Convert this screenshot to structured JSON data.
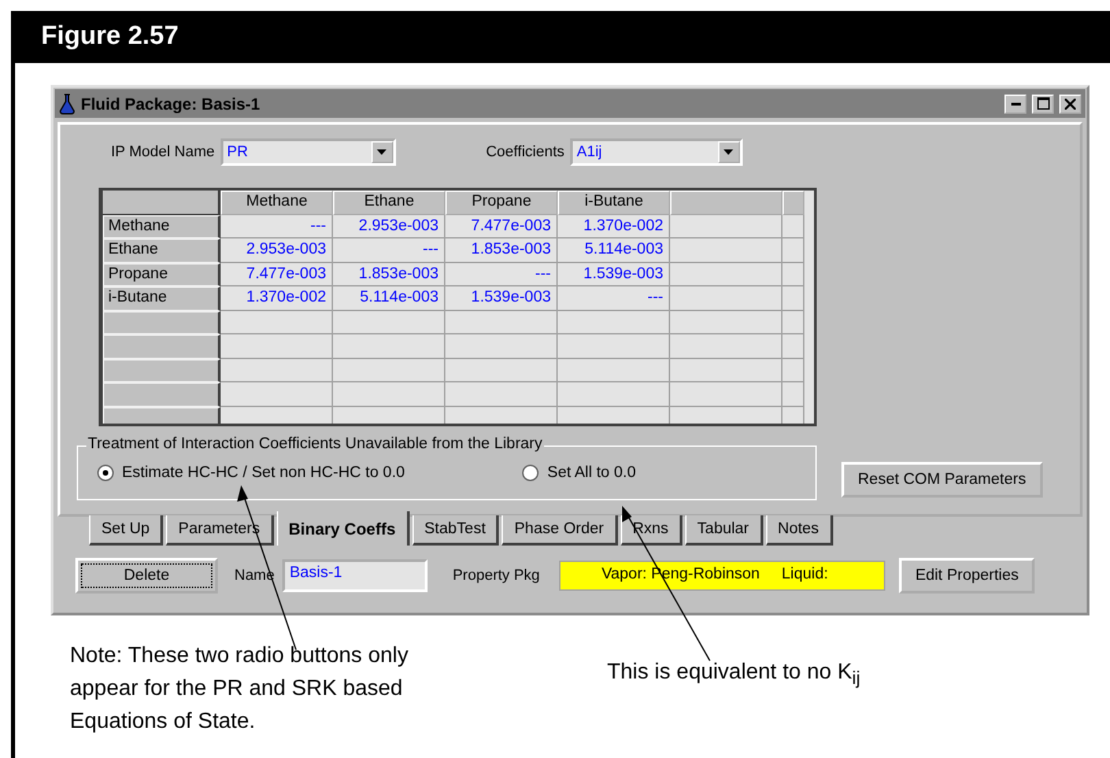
{
  "figure": {
    "title": "Figure 2.57"
  },
  "window": {
    "title": "Fluid Package: Basis-1"
  },
  "ip_model": {
    "label": "IP Model Name",
    "value": "PR"
  },
  "coefficients": {
    "label": "Coefficients",
    "value": "A1ij"
  },
  "table": {
    "columns": [
      "Methane",
      "Ethane",
      "Propane",
      "i-Butane"
    ],
    "rows": [
      {
        "name": "Methane",
        "cells": [
          "---",
          "2.953e-003",
          "7.477e-003",
          "1.370e-002"
        ]
      },
      {
        "name": "Ethane",
        "cells": [
          "2.953e-003",
          "---",
          "1.853e-003",
          "5.114e-003"
        ]
      },
      {
        "name": "Propane",
        "cells": [
          "7.477e-003",
          "1.853e-003",
          "---",
          "1.539e-003"
        ]
      },
      {
        "name": "i-Butane",
        "cells": [
          "1.370e-002",
          "5.114e-003",
          "1.539e-003",
          "---"
        ]
      }
    ]
  },
  "treatment": {
    "title": "Treatment of Interaction Coefficients Unavailable from the Library",
    "options": [
      {
        "label": "Estimate HC-HC / Set non HC-HC to 0.0",
        "selected": true
      },
      {
        "label": "Set All to 0.0",
        "selected": false
      }
    ]
  },
  "reset_button": "Reset COM Parameters",
  "tabs": [
    {
      "label": "Set Up",
      "selected": false
    },
    {
      "label": "Parameters",
      "selected": false
    },
    {
      "label": "Binary Coeffs",
      "selected": true
    },
    {
      "label": "StabTest",
      "selected": false
    },
    {
      "label": "Phase Order",
      "selected": false
    },
    {
      "label": "Rxns",
      "selected": false
    },
    {
      "label": "Tabular",
      "selected": false
    },
    {
      "label": "Notes",
      "selected": false
    }
  ],
  "delete_button": "Delete",
  "name": {
    "label": "Name",
    "value": "Basis-1"
  },
  "property_pkg": {
    "label": "Property Pkg",
    "value": "Vapor: Peng-Robinson     Liquid:"
  },
  "edit_button": "Edit Properties",
  "annotations": [
    {
      "text": "Note: These two radio buttons only appear for the PR and SRK based Equations of State."
    },
    {
      "text": "This is equivalent to no K$_{ij}$"
    }
  ]
}
